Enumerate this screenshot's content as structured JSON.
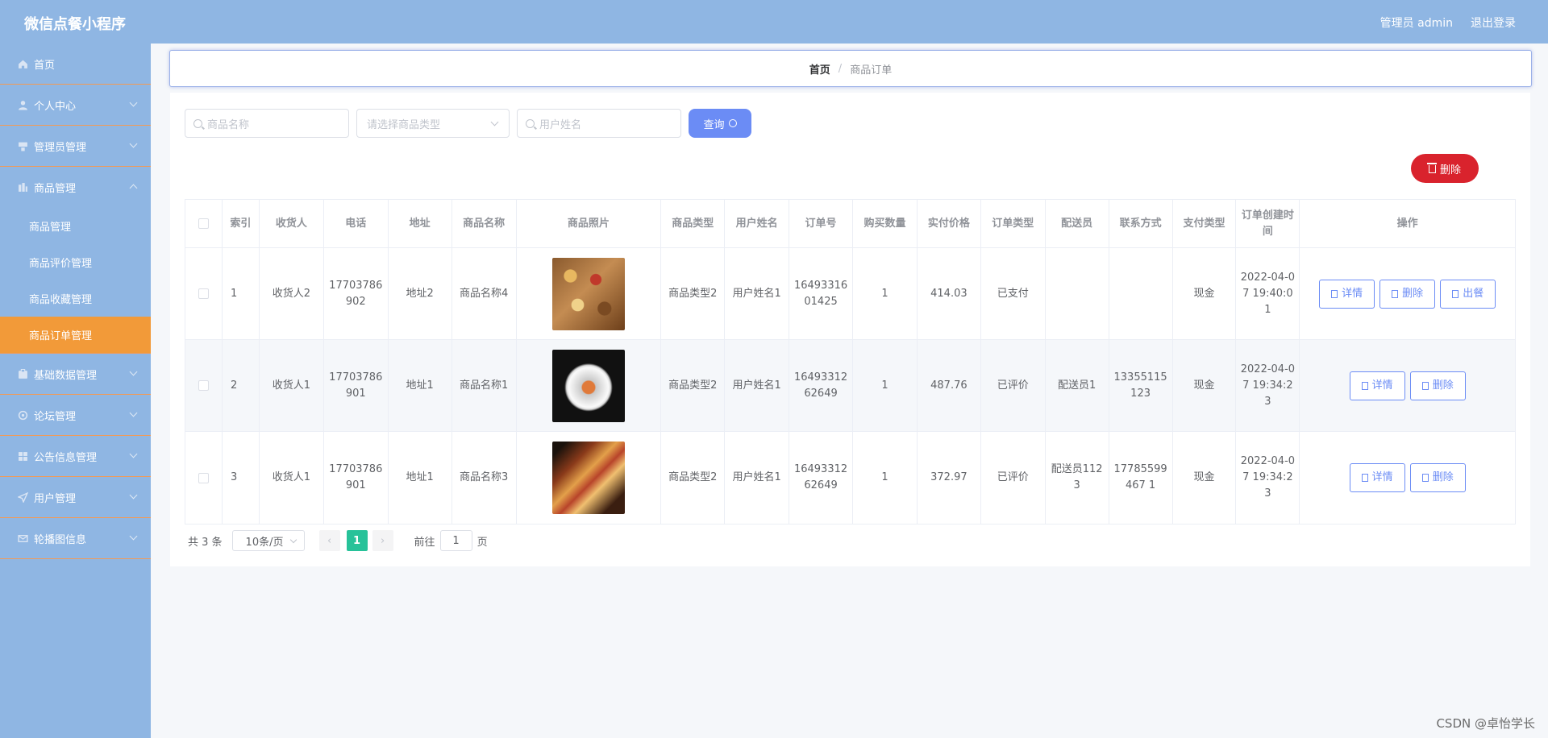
{
  "header": {
    "app_title": "微信点餐小程序",
    "user_label": "管理员 admin",
    "logout_label": "退出登录"
  },
  "sidebar": {
    "items": [
      {
        "label": "首页",
        "icon": "home-icon"
      },
      {
        "label": "个人中心",
        "icon": "user-icon"
      },
      {
        "label": "管理员管理",
        "icon": "admin-icon"
      },
      {
        "label": "商品管理",
        "icon": "goods-icon"
      },
      {
        "label": "基础数据管理",
        "icon": "data-icon"
      },
      {
        "label": "论坛管理",
        "icon": "forum-icon"
      },
      {
        "label": "公告信息管理",
        "icon": "notice-icon"
      },
      {
        "label": "用户管理",
        "icon": "users-icon"
      },
      {
        "label": "轮播图信息",
        "icon": "carousel-icon"
      }
    ],
    "subitems": [
      {
        "label": "商品管理"
      },
      {
        "label": "商品评价管理"
      },
      {
        "label": "商品收藏管理"
      },
      {
        "label": "商品订单管理"
      }
    ]
  },
  "breadcrumb": {
    "home": "首页",
    "separator": "/",
    "current": "商品订单"
  },
  "search": {
    "product_name_placeholder": "商品名称",
    "product_type_placeholder": "请选择商品类型",
    "user_name_placeholder": "用户姓名",
    "query_label": "查询"
  },
  "toolbar": {
    "batch_delete_label": "删除"
  },
  "table": {
    "headers": [
      "索引",
      "收货人",
      "电话",
      "地址",
      "商品名称",
      "商品照片",
      "商品类型",
      "用户姓名",
      "订单号",
      "购买数量",
      "实付价格",
      "订单类型",
      "配送员",
      "联系方式",
      "支付类型",
      "订单创建时间",
      "操作"
    ],
    "rows": [
      {
        "index": "1",
        "receiver": "收货人2",
        "phone": "17703786902",
        "address": "地址2",
        "product_name": "商品名称4",
        "product_type": "商品类型2",
        "user_name": "用户姓名1",
        "order_no": "1649331601425",
        "quantity": "1",
        "price": "414.03",
        "order_type": "已支付",
        "courier": "",
        "contact": "",
        "pay_type": "现金",
        "created": "2022-04-07 19:40:01",
        "actions": [
          "详情",
          "删除",
          "出餐"
        ]
      },
      {
        "index": "2",
        "receiver": "收货人1",
        "phone": "17703786901",
        "address": "地址1",
        "product_name": "商品名称1",
        "product_type": "商品类型2",
        "user_name": "用户姓名1",
        "order_no": "1649331262649",
        "quantity": "1",
        "price": "487.76",
        "order_type": "已评价",
        "courier": "配送员1",
        "contact": "13355115123",
        "pay_type": "现金",
        "created": "2022-04-07 19:34:23",
        "actions": [
          "详情",
          "删除"
        ]
      },
      {
        "index": "3",
        "receiver": "收货人1",
        "phone": "17703786901",
        "address": "地址1",
        "product_name": "商品名称3",
        "product_type": "商品类型2",
        "user_name": "用户姓名1",
        "order_no": "1649331262649",
        "quantity": "1",
        "price": "372.97",
        "order_type": "已评价",
        "courier": "配送员1123",
        "contact": "17785599467 1",
        "pay_type": "现金",
        "created": "2022-04-07 19:34:23",
        "actions": [
          "详情",
          "删除"
        ]
      }
    ]
  },
  "pagination": {
    "total_label": "共 3 条",
    "page_size_label": "10条/页",
    "prev_glyph": "‹",
    "current_page": "1",
    "next_glyph": "›",
    "goto_label": "前往",
    "goto_value": "1",
    "page_suffix": "页"
  },
  "watermark": "CSDN @卓怡学长",
  "colors": {
    "sidebar_bg": "#8fb6e3",
    "active_menu": "#f29a39",
    "primary": "#6b8cf5",
    "danger": "#d9232d",
    "pager_active": "#27c299"
  }
}
